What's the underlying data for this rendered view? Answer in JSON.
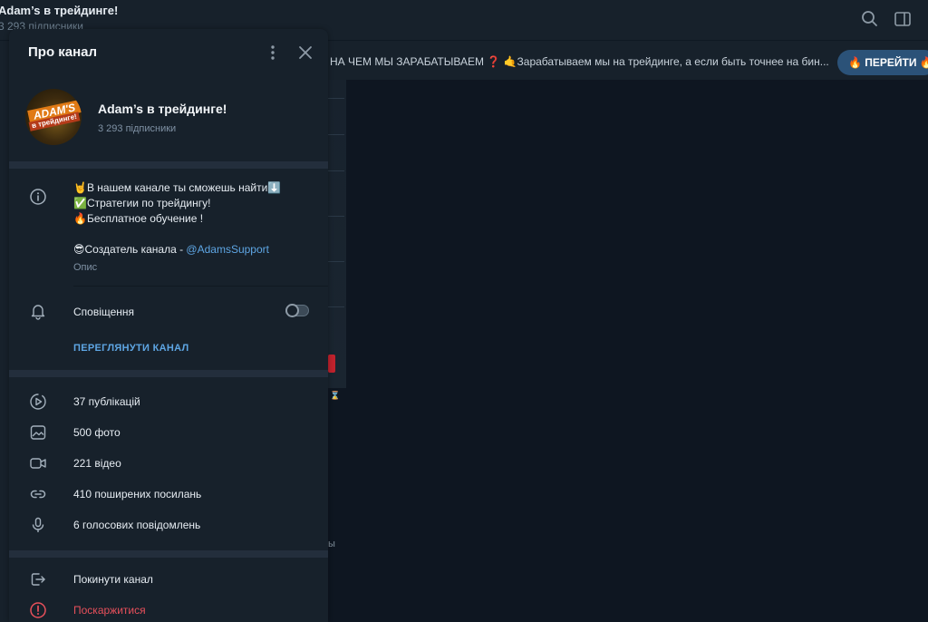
{
  "background": {
    "chat_title": "Adam’s в трейдинге!",
    "chat_subscribers": "3 293 підписники",
    "pinned_text": "НА ЧЕМ МЫ ЗАРАБАТЫВАЕМ ❓ 🤙Зарабатываем мы на трейдинге, а если быть точнее на бин...",
    "pinned_button": "🔥 ПЕРЕЙТИ 🔥",
    "ghost_text": "ы",
    "hourglass": "⌛"
  },
  "panel": {
    "title": "Про канал",
    "channel": {
      "name": "Adam’s в трейдинге!",
      "subscribers": "3 293 підписники",
      "avatar_text_top": "ADAM'S",
      "avatar_text_bottom": "в трейдинге!"
    },
    "description": {
      "line1": "🤘В нашем канале ты сможешь найти⬇️",
      "line2": "✅Стратегии по трейдингу!",
      "line3": "🔥Бесплатное обучение !",
      "line4_prefix": "😎Создатель канала - ",
      "line4_link": "@AdamsSupport",
      "label": "Опис"
    },
    "notifications": {
      "label": "Сповіщення",
      "enabled": false
    },
    "view_channel": "ПЕРЕГЛЯНУТИ КАНАЛ",
    "media": [
      {
        "label": "37 публікацій",
        "icon": "posts-icon"
      },
      {
        "label": "500 фото",
        "icon": "photo-icon"
      },
      {
        "label": "221 відео",
        "icon": "video-icon"
      },
      {
        "label": "410 поширених посилань",
        "icon": "link-icon"
      },
      {
        "label": "6 голосових повідомлень",
        "icon": "microphone-icon"
      }
    ],
    "actions": {
      "leave": "Покинути канал",
      "report": "Поскаржитися"
    },
    "colors": {
      "accent": "#5ea6e4",
      "danger": "#e8505b",
      "panel_bg": "#17212b",
      "separator": "#232e3c"
    }
  }
}
